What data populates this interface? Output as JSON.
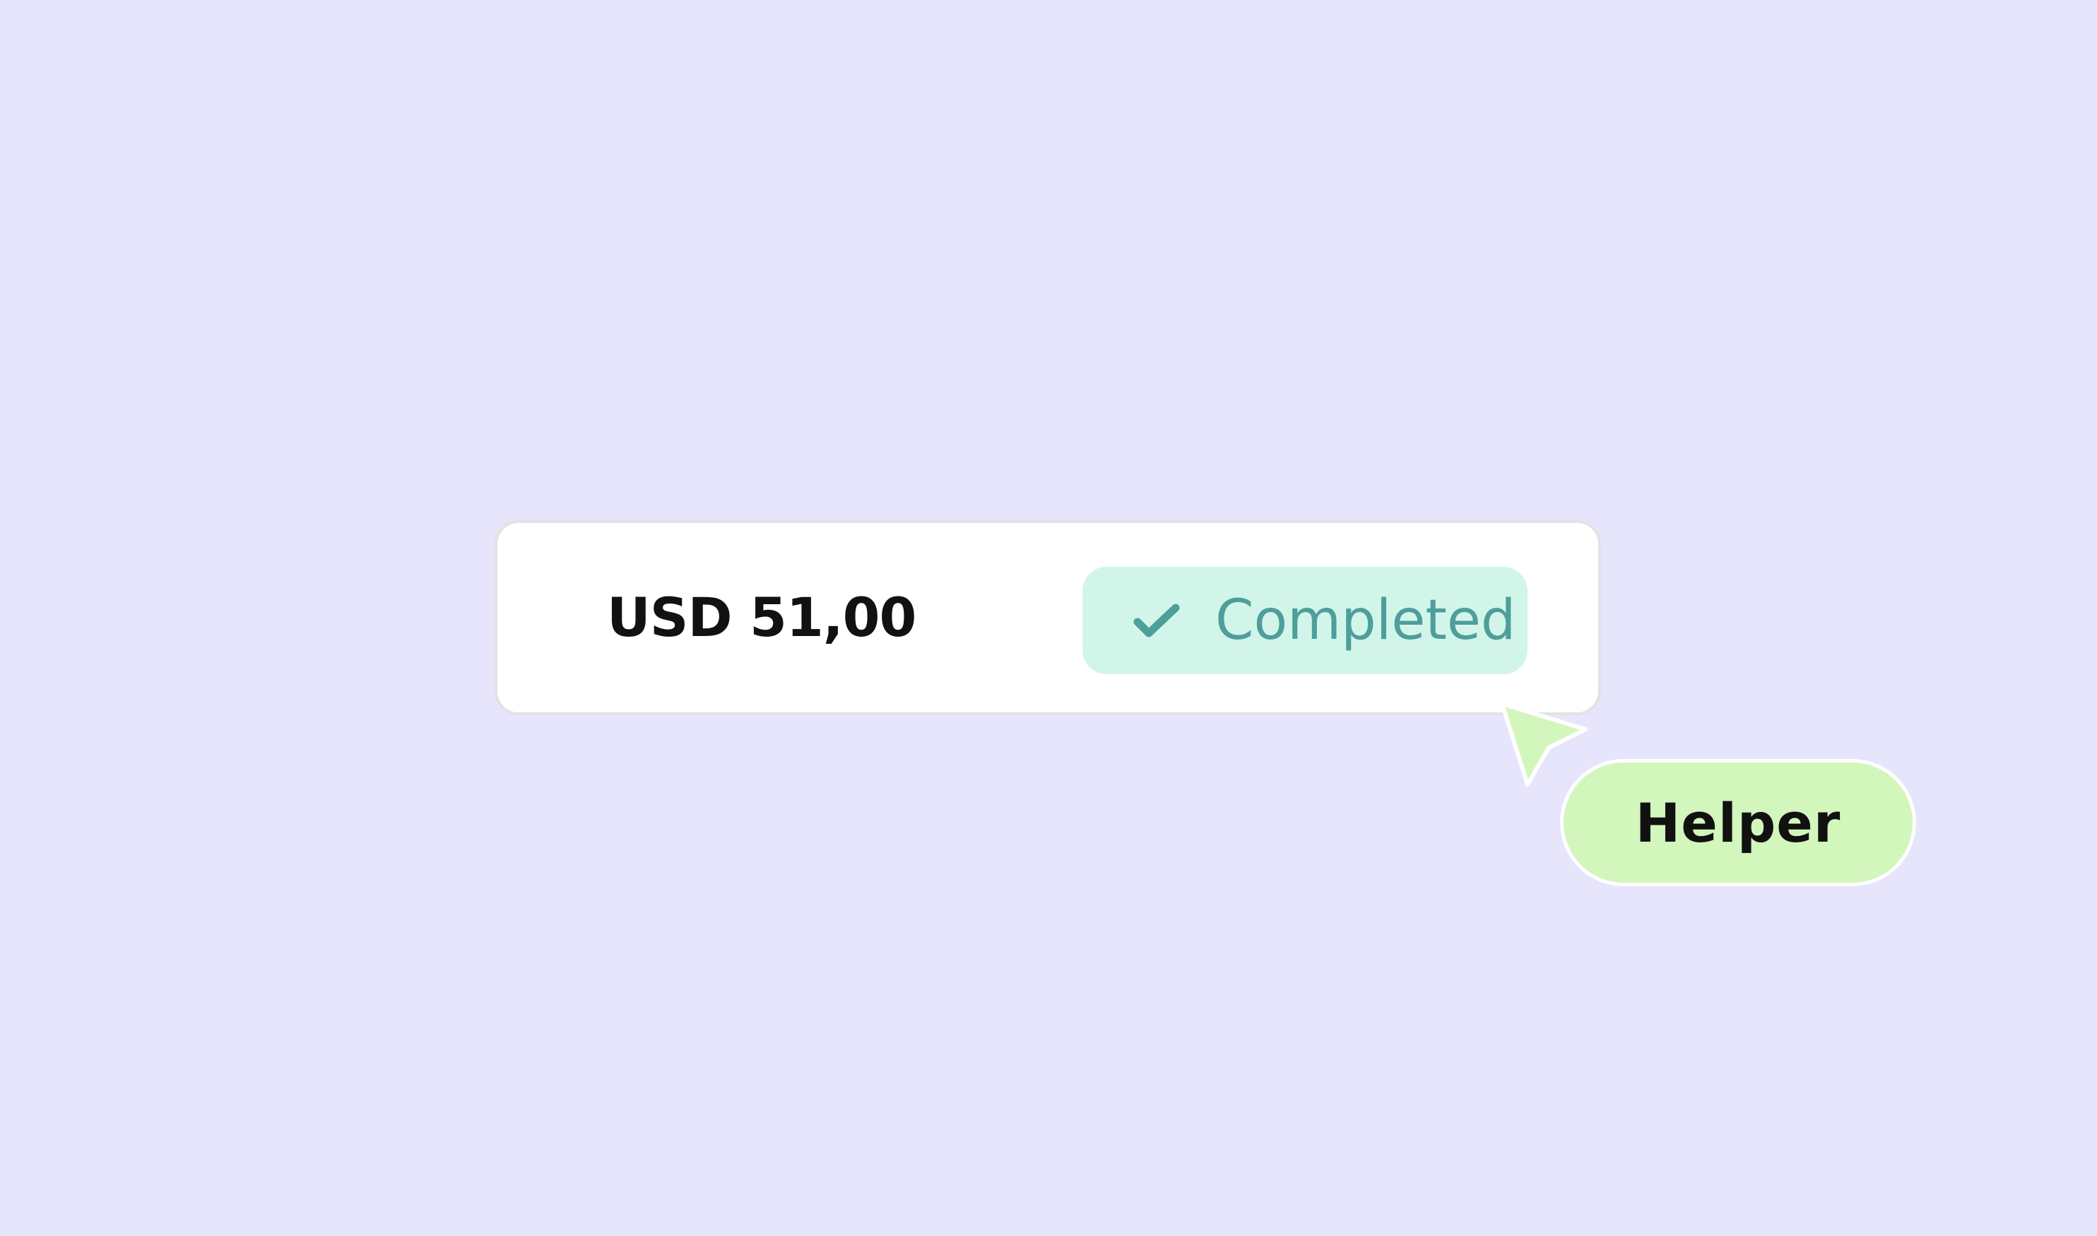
{
  "transaction": {
    "amount": "USD 51,00",
    "status": {
      "label": "Completed",
      "icon": "check-icon"
    }
  },
  "helper": {
    "label": "Helper",
    "pointer_icon": "cursor-pointer-icon"
  },
  "colors": {
    "background": "#E6E5FC",
    "card": "#FFFFFF",
    "card_border": "#E2E2E2",
    "status_badge_bg": "#D2F5EA",
    "status_text": "#4E9E9B",
    "helper_bg": "#D2F6BC",
    "text_dark": "#111111"
  }
}
